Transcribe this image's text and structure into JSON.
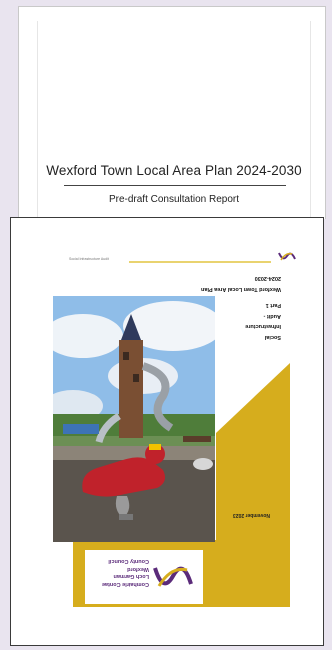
{
  "cover_top": {
    "title": "Wexford Town Local Area Plan 2024-2030",
    "subtitle": "Pre-draft Consultation Report"
  },
  "cover_bottom": {
    "header_small": "Social Infrastructure Audit",
    "plan_title_lines": [
      "Wexford Town Local Area Plan",
      "2024-2030"
    ],
    "report_lines": [
      "Social",
      "Infrastructure",
      "Audit -",
      "Part 1"
    ],
    "date": "November 2023",
    "council_lines": [
      "Comhairle Contae",
      "Loch Garman",
      "Wexford",
      "County Council"
    ]
  },
  "colors": {
    "gold": "#d6ad1d",
    "purple": "#5b2b7a",
    "background": "#e9e4ef"
  }
}
